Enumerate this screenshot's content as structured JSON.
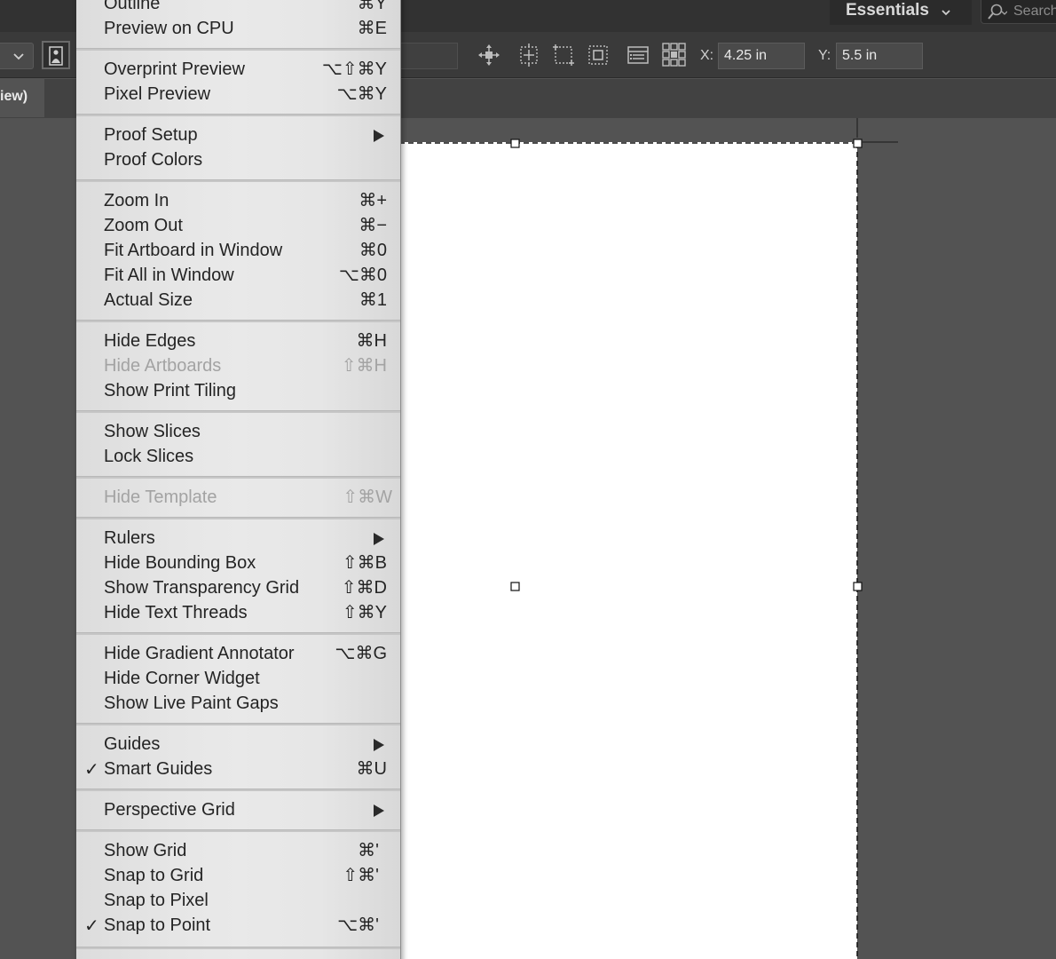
{
  "header": {
    "workspace_label": "Essentials",
    "search_placeholder": "Search"
  },
  "control_bar": {
    "x_label": "X:",
    "x_value": "4.25 in",
    "y_label": "Y:",
    "y_value": "5.5 in"
  },
  "document_tab": {
    "label": "iew)"
  },
  "view_menu": {
    "items": [
      {
        "label": "Outline",
        "shortcut": "⌘Y"
      },
      {
        "label": "Preview on CPU",
        "shortcut": "⌘E"
      },
      {
        "label": "Overprint Preview",
        "shortcut": "⌥⇧⌘Y"
      },
      {
        "label": "Pixel Preview",
        "shortcut": "⌥⌘Y"
      },
      {
        "label": "Proof Setup",
        "shortcut": ""
      },
      {
        "label": "Proof Colors",
        "shortcut": ""
      },
      {
        "label": "Zoom In",
        "shortcut": "⌘+"
      },
      {
        "label": "Zoom Out",
        "shortcut": "⌘−"
      },
      {
        "label": "Fit Artboard in Window",
        "shortcut": "⌘0"
      },
      {
        "label": "Fit All in Window",
        "shortcut": "⌥⌘0"
      },
      {
        "label": "Actual Size",
        "shortcut": "⌘1"
      },
      {
        "label": "Hide Edges",
        "shortcut": "⌘H"
      },
      {
        "label": "Hide Artboards",
        "shortcut": "⇧⌘H"
      },
      {
        "label": "Show Print Tiling",
        "shortcut": ""
      },
      {
        "label": "Show Slices",
        "shortcut": ""
      },
      {
        "label": "Lock Slices",
        "shortcut": ""
      },
      {
        "label": "Hide Template",
        "shortcut": "⇧⌘W"
      },
      {
        "label": "Rulers",
        "shortcut": ""
      },
      {
        "label": "Hide Bounding Box",
        "shortcut": "⇧⌘B"
      },
      {
        "label": "Show Transparency Grid",
        "shortcut": "⇧⌘D"
      },
      {
        "label": "Hide Text Threads",
        "shortcut": "⇧⌘Y"
      },
      {
        "label": "Hide Gradient Annotator",
        "shortcut": "⌥⌘G"
      },
      {
        "label": "Hide Corner Widget",
        "shortcut": ""
      },
      {
        "label": "Show Live Paint Gaps",
        "shortcut": ""
      },
      {
        "label": "Guides",
        "shortcut": ""
      },
      {
        "label": "Smart Guides",
        "shortcut": "⌘U"
      },
      {
        "label": "Perspective Grid",
        "shortcut": ""
      },
      {
        "label": "Show Grid",
        "shortcut": "⌘'"
      },
      {
        "label": "Snap to Grid",
        "shortcut": "⇧⌘'"
      },
      {
        "label": "Snap to Pixel",
        "shortcut": ""
      },
      {
        "label": "Snap to Point",
        "shortcut": "⌥⌘'"
      }
    ],
    "checkmark": "✓"
  }
}
